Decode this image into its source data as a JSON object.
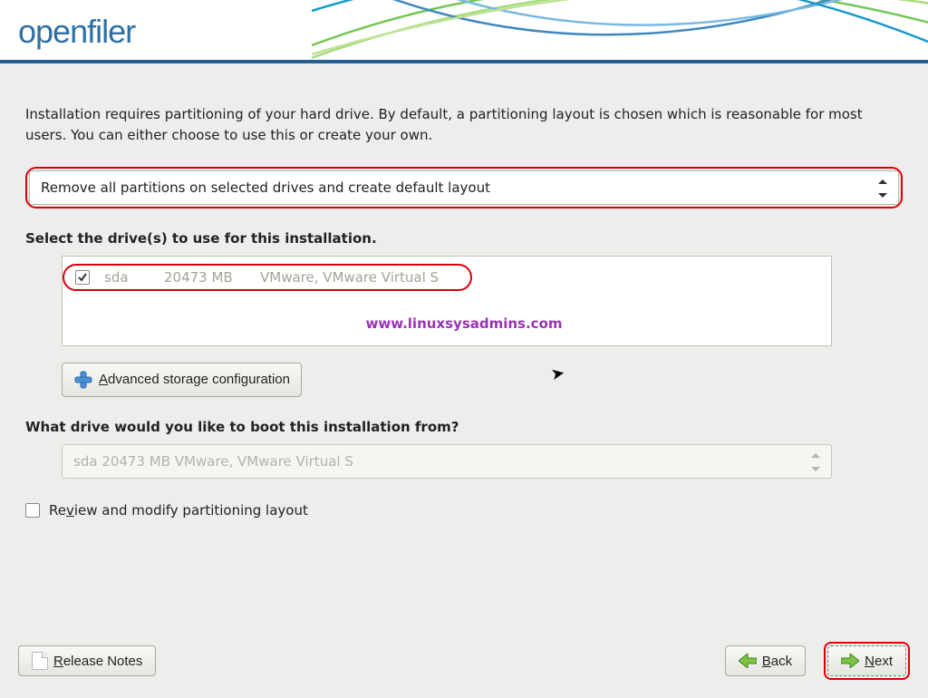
{
  "brand": "openfiler",
  "intro_text": "Installation requires partitioning of your hard drive.  By default, a partitioning layout is chosen which is reasonable for most users.  You can either choose to use this or create your own.",
  "partition_dropdown": {
    "selected": "Remove all partitions on selected drives and create default layout"
  },
  "drives_label": "Select the drive(s) to use for this installation.",
  "drive": {
    "name": "sda",
    "size": "20473 MB",
    "desc": "VMware, VMware Virtual S"
  },
  "adv_button_text": "dvanced storage configuration",
  "adv_button_prefix": "A",
  "boot_label": "What drive would you like to boot this installation from?",
  "boot_dropdown": {
    "selected": "sda    20473 MB VMware, VMware Virtual S"
  },
  "review_prefix": "Re",
  "review_underline": "v",
  "review_suffix": "iew and modify partitioning layout",
  "watermark": "www.linuxsysadmins.com",
  "release_prefix": "R",
  "release_text": "elease Notes",
  "back_prefix": "B",
  "back_text": "ack",
  "next_prefix": "N",
  "next_text": "ext"
}
